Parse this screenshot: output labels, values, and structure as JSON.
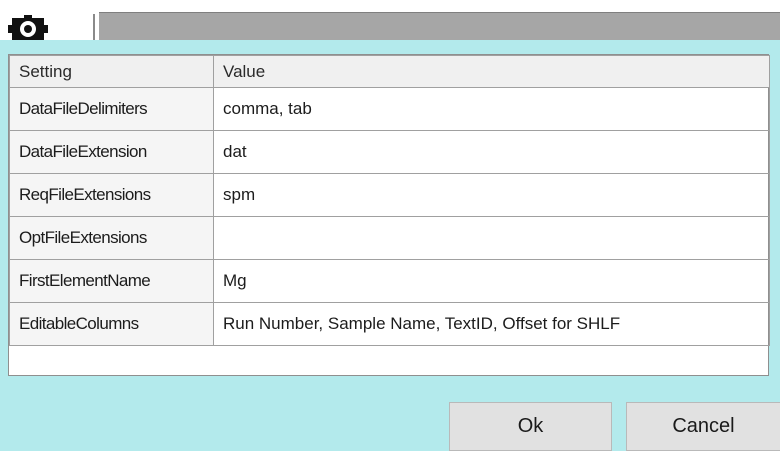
{
  "toolbar": {
    "icon": "gear-icon"
  },
  "grid": {
    "columns": [
      "Setting",
      "Value"
    ],
    "rows": [
      {
        "setting": "DataFileDelimiters",
        "value": "comma, tab"
      },
      {
        "setting": "DataFileExtension",
        "value": "dat"
      },
      {
        "setting": "ReqFileExtensions",
        "value": "spm"
      },
      {
        "setting": "OptFileExtensions",
        "value": ""
      },
      {
        "setting": "FirstElementName",
        "value": "Mg"
      },
      {
        "setting": "EditableColumns",
        "value": "Run Number, Sample Name, TextID, Offset for SHLF"
      }
    ]
  },
  "buttons": {
    "ok_label": "Ok",
    "cancel_label": "Cancel"
  },
  "colors": {
    "panel_bg": "#b3eaec",
    "strip": "#a6a6a6"
  }
}
